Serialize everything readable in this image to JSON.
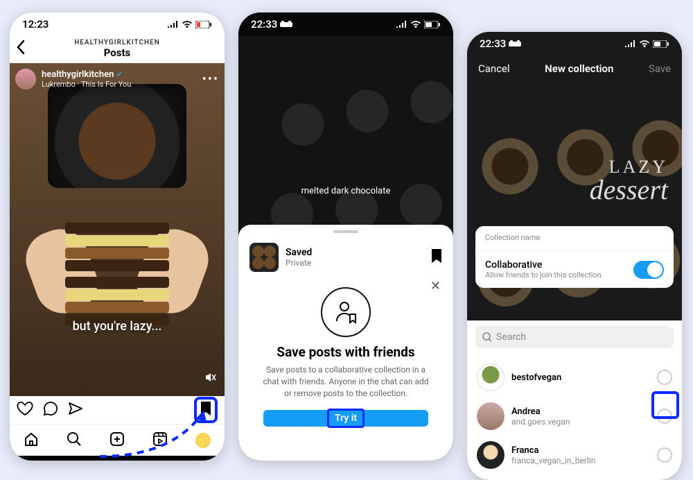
{
  "screen1": {
    "status_time": "12:23",
    "header_sub": "HEALTHYGIRLKITCHEN",
    "header_title": "Posts",
    "username": "healthygirlkitchen",
    "audio": "Lukrembo · This Is For You",
    "caption": "but you're lazy..."
  },
  "screen2": {
    "status_time": "22:33",
    "overlay_caption": "melted dark chocolate",
    "saved_title": "Saved",
    "saved_sub": "Private",
    "promo_title": "Save posts with friends",
    "promo_body": "Save posts to a collaborative collection in a chat with friends. Anyone in the chat can add or remove posts to the collection.",
    "try_label": "Try it"
  },
  "screen3": {
    "status_time": "22:33",
    "cancel": "Cancel",
    "title": "New collection",
    "save": "Save",
    "lazy1": "LAZY",
    "lazy2": "dessert",
    "collection_label": "Collection name",
    "collab_title": "Collaborative",
    "collab_sub": "Allow friends to join this collection",
    "search_placeholder": "Search",
    "friends": [
      {
        "name": "bestofvegan",
        "sub": ""
      },
      {
        "name": "Andrea",
        "sub": "and.goes.vegan"
      },
      {
        "name": "Franca",
        "sub": "franca_vegan_in_berlin"
      }
    ]
  }
}
